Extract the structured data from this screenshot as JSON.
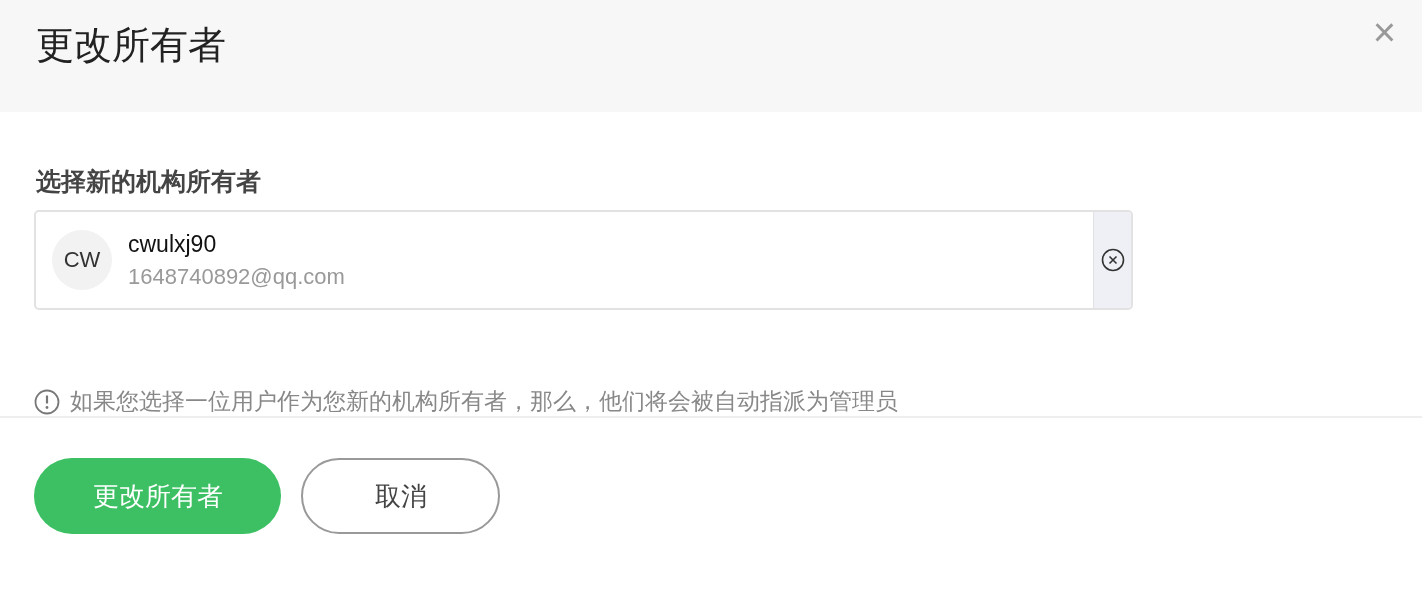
{
  "dialog": {
    "title": "更改所有者",
    "close": "×"
  },
  "owner_field": {
    "label": "选择新的机构所有者",
    "avatar": "CW",
    "name": "cwulxj90",
    "email": "1648740892@qq.com"
  },
  "notice": "如果您选择一位用户作为您新的机构所有者，那么，他们将会被自动指派为管理员",
  "buttons": [
    {
      "label": "更改所有者",
      "kind": "primary"
    },
    {
      "label": "取消",
      "kind": "secondary"
    }
  ]
}
